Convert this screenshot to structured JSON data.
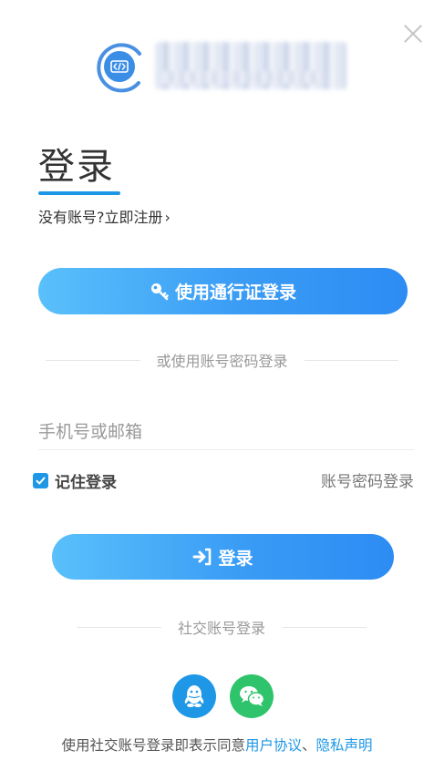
{
  "header": {
    "title": "登录",
    "register_prompt": "没有账号?立即注册",
    "chevron": "›"
  },
  "buttons": {
    "passport_login": "使用通行证登录",
    "login": "登录"
  },
  "dividers": {
    "account_password": "或使用账号密码登录",
    "social": "社交账号登录"
  },
  "form": {
    "account_placeholder": "手机号或邮箱",
    "account_value": "",
    "remember_label": "记住登录",
    "remember_checked": true,
    "password_login_link": "账号密码登录"
  },
  "agreement": {
    "prefix": "使用社交账号登录即表示同意",
    "user_agreement": "用户协议",
    "separator": "、",
    "privacy": "隐私声明"
  },
  "icons": {
    "close": "close-icon",
    "logo": "code-icon",
    "key": "key-icon",
    "login": "sign-in-icon",
    "qq": "qq-icon",
    "wechat": "wechat-icon",
    "check": "check-icon"
  },
  "colors": {
    "accent": "#1e97e6",
    "gradient_start": "#5ac0fb",
    "gradient_end": "#2d8cf3",
    "wechat": "#2fc46b",
    "qq": "#1e97e6"
  }
}
